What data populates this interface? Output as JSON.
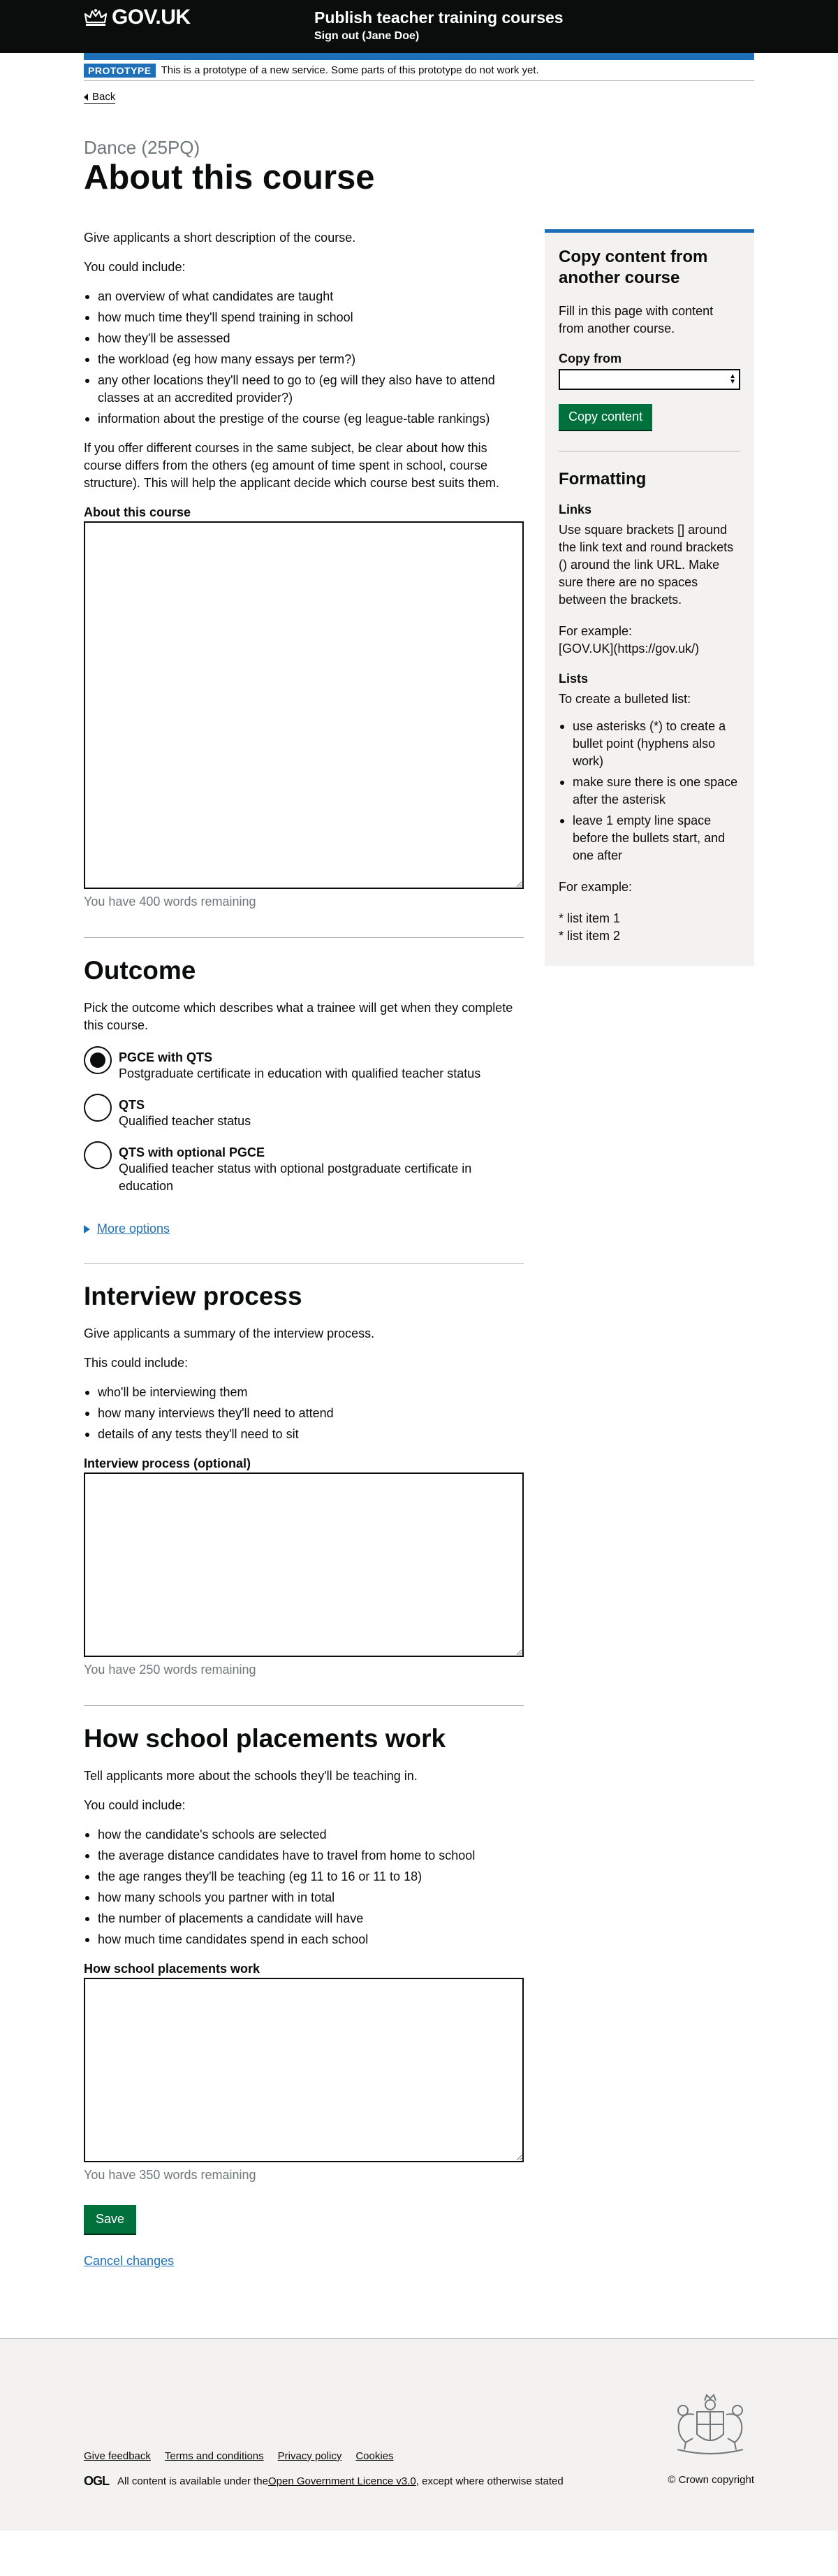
{
  "header": {
    "logo": "GOV.UK",
    "service_name": "Publish teacher training courses",
    "sign_out": "Sign out (Jane Doe)"
  },
  "banner": {
    "tag": "PROTOTYPE",
    "text": "This is a prototype of a new service. Some parts of this prototype do not work yet."
  },
  "back_link": "Back",
  "caption": "Dance (25PQ)",
  "title": "About this course",
  "about": {
    "intro": "Give applicants a short description of the course.",
    "could_include": "You could include:",
    "items": [
      "an overview of what candidates are taught",
      "how much time they'll spend training in school",
      "how they'll be assessed",
      "the workload (eg how many essays per term?)",
      "any other locations they'll need to go to (eg will they also have to attend classes at an accredited provider?)",
      "information about the prestige of the course (eg league-table rankings)"
    ],
    "note": "If you offer different courses in the same subject, be clear about how this course differs from the others (eg amount of time spent in school, course structure). This will help the applicant decide which course best suits them.",
    "label": "About this course",
    "value": "",
    "remaining": "You have 400 words remaining"
  },
  "outcome": {
    "heading": "Outcome",
    "hint": "Pick the outcome which describes what a trainee will get when they complete this course.",
    "options": [
      {
        "title": "PGCE with QTS",
        "hint": "Postgraduate certificate in education with qualified teacher status"
      },
      {
        "title": "QTS",
        "hint": "Qualified teacher status"
      },
      {
        "title": "QTS with optional PGCE",
        "hint": "Qualified teacher status with optional postgraduate certificate in education"
      }
    ],
    "selected": "PGCE with QTS",
    "more": "More options"
  },
  "interview": {
    "heading": "Interview process",
    "intro": "Give applicants a summary of the interview process.",
    "could_include": "This could include:",
    "items": [
      "who'll be interviewing them",
      "how many interviews they'll need to attend",
      "details of any tests they'll need to sit"
    ],
    "label": "Interview process (optional)",
    "value": "",
    "remaining": "You have 250 words remaining"
  },
  "placements": {
    "heading": "How school placements work",
    "intro": "Tell applicants more about the schools they'll be teaching in.",
    "could_include": "You could include:",
    "items": [
      "how the candidate's schools are selected",
      "the average distance candidates have to travel from home to school",
      "the age ranges they'll be teaching (eg 11 to 16 or 11 to 18)",
      "how many schools you partner with in total",
      "the number of placements a candidate will have",
      "how much time candidates spend in each school"
    ],
    "label": "How school placements work",
    "value": "",
    "remaining": "You have 350 words remaining"
  },
  "save": "Save",
  "cancel": "Cancel changes",
  "aside": {
    "heading": "Copy content from another course",
    "text": "Fill in this page with content from another course.",
    "copy_from_label": "Copy from",
    "copy_from_value": "",
    "copy_button": "Copy content",
    "formatting_heading": "Formatting",
    "links_heading": "Links",
    "links_text": "Use square brackets [] around the link text and round brackets () around the link URL. Make sure there are no spaces between the brackets.",
    "links_example_label": "For example:",
    "links_example": "[GOV.UK](https://gov.uk/)",
    "lists_heading": "Lists",
    "lists_intro": "To create a bulleted list:",
    "lists_items": [
      "use asterisks (*) to create a bullet point (hyphens also work)",
      "make sure there is one space after the asterisk",
      "leave 1 empty line space before the bullets start, and one after"
    ],
    "lists_example_label": "For example:",
    "lists_example": [
      "* list item 1",
      "* list item 2"
    ]
  },
  "footer": {
    "links": [
      "Give feedback",
      "Terms and conditions",
      "Privacy policy",
      "Cookies"
    ],
    "ogl_logo": "OGL",
    "licence_prefix": "All content is available under the ",
    "licence_link": "Open Government Licence v3.0",
    "licence_suffix": ", except where otherwise stated",
    "copyright": "© Crown copyright"
  },
  "colors": {
    "header_bg": "#0b0c0c",
    "brand_blue": "#1d70b8",
    "button_green": "#00703c",
    "panel_bg": "#f3f2f1",
    "secondary_text": "#6f777b"
  }
}
